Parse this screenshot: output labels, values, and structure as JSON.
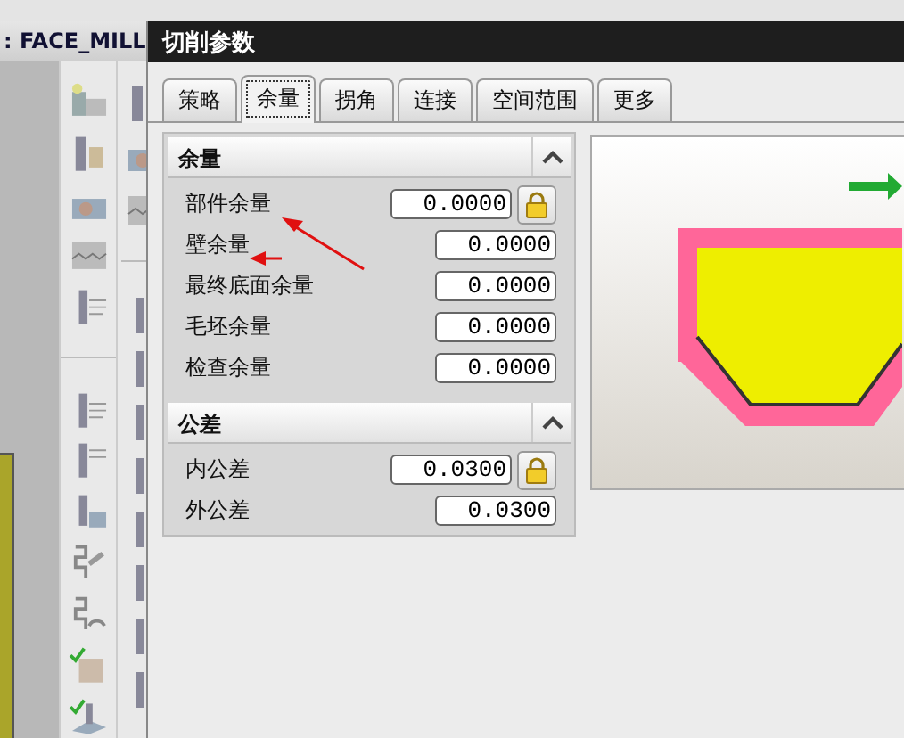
{
  "app": {
    "operation_label": ": FACE_MILL"
  },
  "dialog": {
    "title": "切削参数",
    "tabs": [
      {
        "label": "策略",
        "selected": false
      },
      {
        "label": "余量",
        "selected": true
      },
      {
        "label": "拐角",
        "selected": false
      },
      {
        "label": "连接",
        "selected": false
      },
      {
        "label": "空间范围",
        "selected": false
      },
      {
        "label": "更多",
        "selected": false
      }
    ],
    "sections": [
      {
        "title": "余量",
        "expanded": true,
        "rows": [
          {
            "label": "部件余量",
            "value": "0.0000",
            "locked": true
          },
          {
            "label": "壁余量",
            "value": "0.0000",
            "locked": false
          },
          {
            "label": "最终底面余量",
            "value": "0.0000",
            "locked": false
          },
          {
            "label": "毛坯余量",
            "value": "0.0000",
            "locked": false
          },
          {
            "label": "检查余量",
            "value": "0.0000",
            "locked": false
          }
        ]
      },
      {
        "title": "公差",
        "expanded": true,
        "rows": [
          {
            "label": "内公差",
            "value": "0.0300",
            "locked": true
          },
          {
            "label": "外公差",
            "value": "0.0300",
            "locked": false
          }
        ]
      }
    ]
  }
}
